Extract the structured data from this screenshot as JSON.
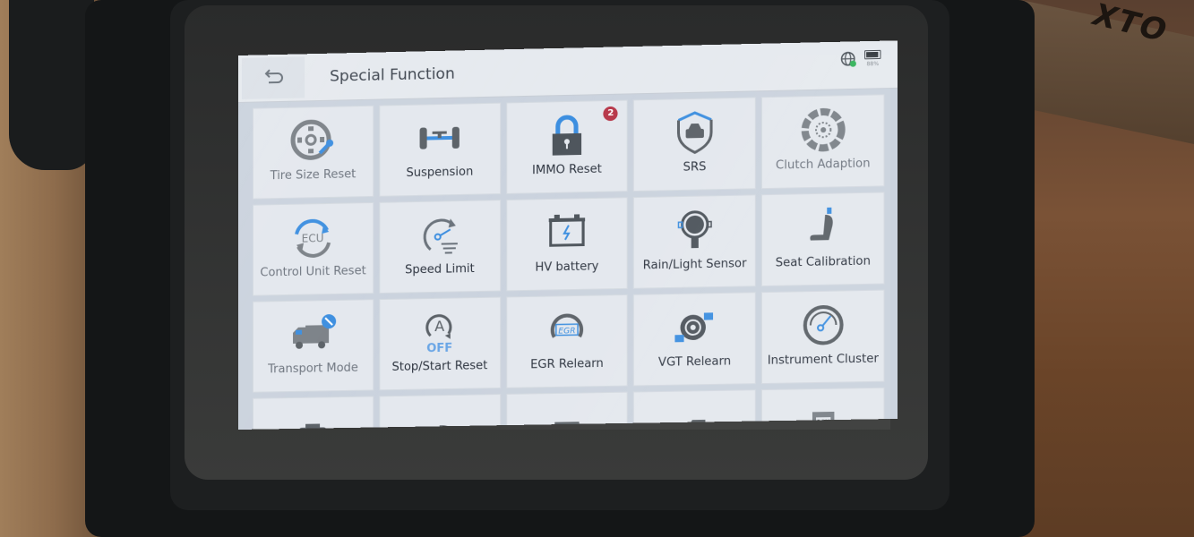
{
  "environment": {
    "box_brand_text": "XTO"
  },
  "header": {
    "title": "Special Function",
    "back_icon": "back-arrow-icon",
    "status": {
      "network_icon": "globe-connected-icon",
      "battery_icon": "battery-icon",
      "battery_text": "88%"
    }
  },
  "functions": [
    {
      "label": "Tire Size Reset",
      "icon": "tire-wrench-icon",
      "dim": true
    },
    {
      "label": "Suspension",
      "icon": "suspension-axle-icon"
    },
    {
      "label": "IMMO Reset",
      "icon": "padlock-icon",
      "badge": "2"
    },
    {
      "label": "SRS",
      "icon": "shield-car-icon"
    },
    {
      "label": "Clutch Adaption",
      "icon": "clutch-disc-icon",
      "dim": true
    },
    {
      "label": "Control Unit Reset",
      "icon": "ecu-refresh-icon",
      "dim": true
    },
    {
      "label": "Speed Limit",
      "icon": "speedometer-icon"
    },
    {
      "label": "HV battery",
      "icon": "battery-bolt-icon"
    },
    {
      "label": "Rain/Light Sensor",
      "icon": "sensor-icon"
    },
    {
      "label": "Seat Calibration",
      "icon": "seat-icon"
    },
    {
      "label": "Transport Mode",
      "icon": "truck-icon",
      "dim": true
    },
    {
      "label": "Stop/Start Reset",
      "icon": "auto-stop-off-icon"
    },
    {
      "label": "EGR Relearn",
      "icon": "egr-icon"
    },
    {
      "label": "VGT Relearn",
      "icon": "turbo-icon"
    },
    {
      "label": "Instrument Cluster",
      "icon": "gauge-icon"
    },
    {
      "label": "",
      "icon": "engine-cover-icon"
    },
    {
      "label": "",
      "icon": "headlight-icon"
    },
    {
      "label": "",
      "icon": "auto-a-icon"
    },
    {
      "label": "",
      "icon": "window-door-icon"
    },
    {
      "label": "",
      "icon": "rom-chip-icon"
    }
  ],
  "colors": {
    "accent_blue": "#3d8fe0",
    "icon_gray": "#5c6268",
    "badge_red": "#b8384a",
    "tile_bg": "#e4e8ee"
  }
}
